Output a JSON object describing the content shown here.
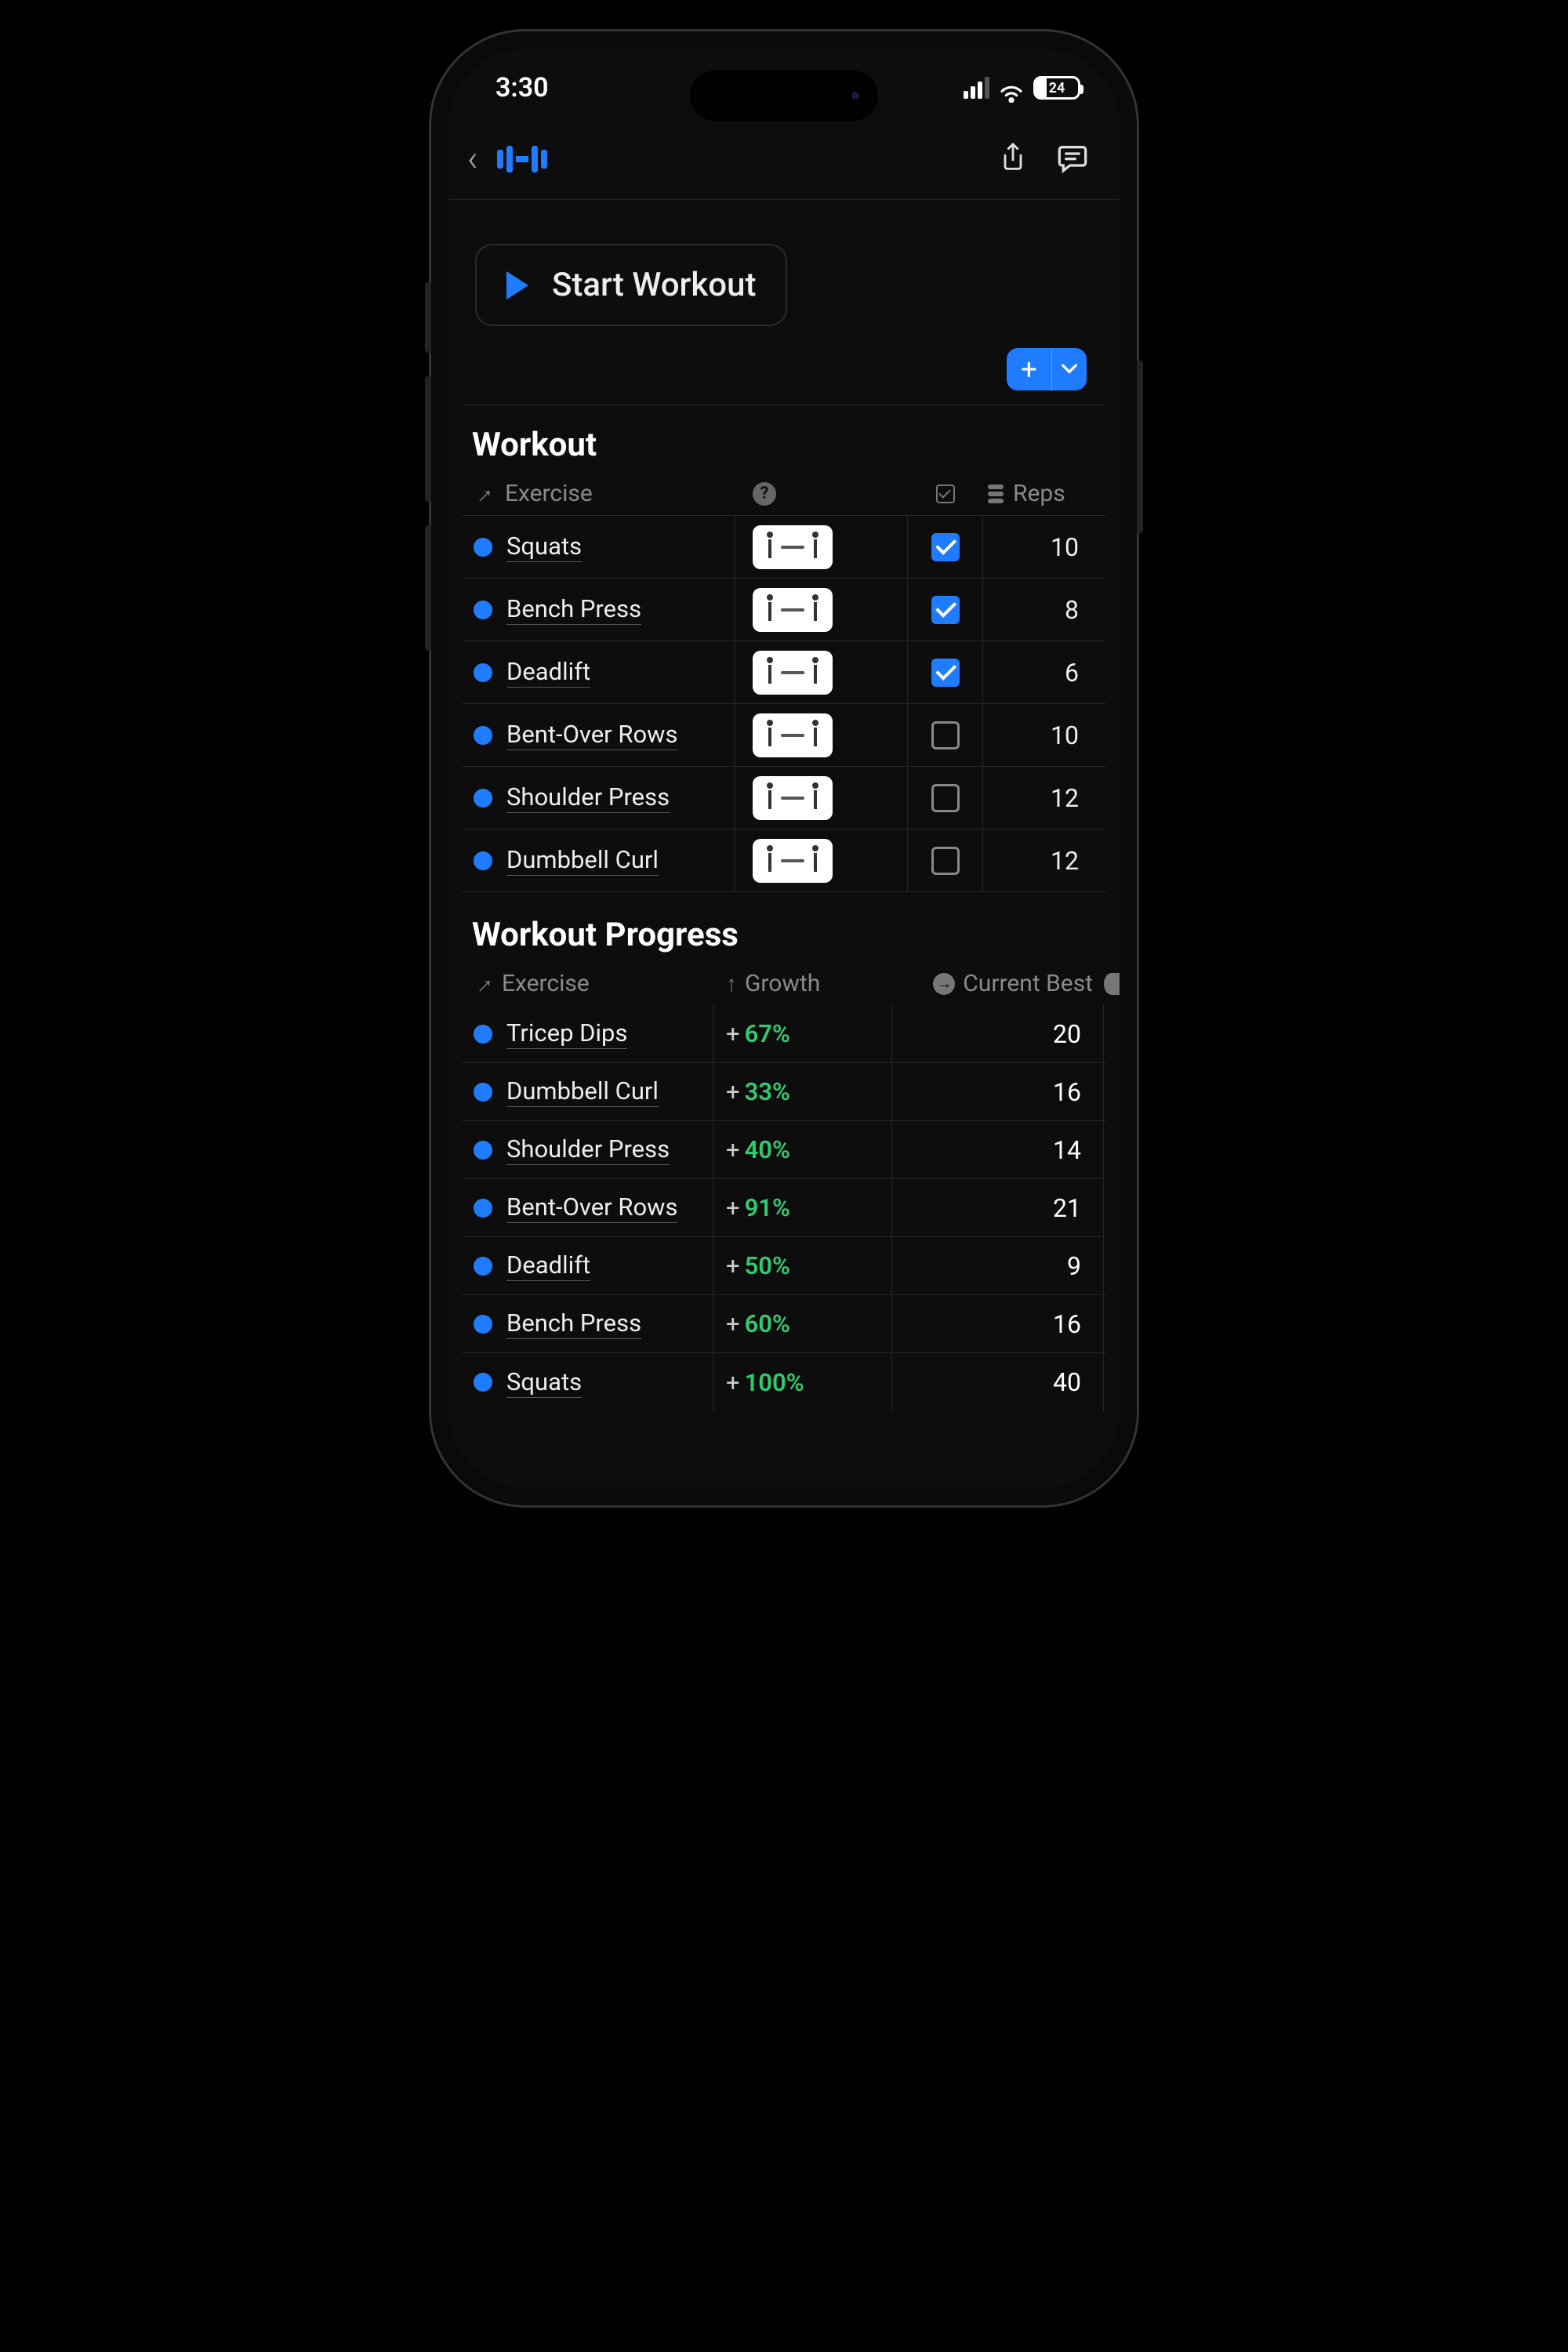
{
  "status": {
    "time": "3:30",
    "battery": "24"
  },
  "start_label": "Start Workout",
  "sections": {
    "workout_title": "Workout",
    "progress_title": "Workout Progress"
  },
  "workout_headers": {
    "exercise": "Exercise",
    "reps": "Reps"
  },
  "workout_rows": [
    {
      "name": "Squats",
      "checked": true,
      "reps": "10"
    },
    {
      "name": "Bench Press",
      "checked": true,
      "reps": "8"
    },
    {
      "name": "Deadlift",
      "checked": true,
      "reps": "6"
    },
    {
      "name": "Bent-Over Rows",
      "checked": false,
      "reps": "10"
    },
    {
      "name": "Shoulder Press",
      "checked": false,
      "reps": "12"
    },
    {
      "name": "Dumbbell Curl",
      "checked": false,
      "reps": "12"
    }
  ],
  "progress_headers": {
    "exercise": "Exercise",
    "growth": "Growth",
    "current_best": "Current Best"
  },
  "progress_rows": [
    {
      "name": "Tricep Dips",
      "growth": "67%",
      "best": "20"
    },
    {
      "name": "Dumbbell Curl",
      "growth": "33%",
      "best": "16"
    },
    {
      "name": "Shoulder Press",
      "growth": "40%",
      "best": "14"
    },
    {
      "name": "Bent-Over Rows",
      "growth": "91%",
      "best": "21"
    },
    {
      "name": "Deadlift",
      "growth": "50%",
      "best": "9"
    },
    {
      "name": "Bench Press",
      "growth": "60%",
      "best": "16"
    },
    {
      "name": "Squats",
      "growth": "100%",
      "best": "40"
    }
  ]
}
